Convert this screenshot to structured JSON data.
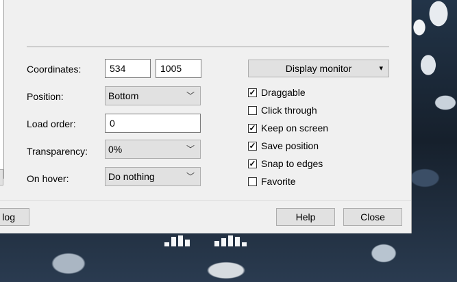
{
  "form": {
    "coordinates_label": "Coordinates:",
    "coord_x": "534",
    "coord_y": "1005",
    "position_label": "Position:",
    "position_value": "Bottom",
    "load_order_label": "Load order:",
    "load_order_value": "0",
    "transparency_label": "Transparency:",
    "transparency_value": "0%",
    "on_hover_label": "On hover:",
    "on_hover_value": "Do nothing"
  },
  "monitor": {
    "button_label": "Display monitor",
    "dropdown_glyph": "▾"
  },
  "options": [
    {
      "label": "Draggable",
      "checked": true
    },
    {
      "label": "Click through",
      "checked": false
    },
    {
      "label": "Keep on screen",
      "checked": true
    },
    {
      "label": "Save position",
      "checked": true
    },
    {
      "label": "Snap to edges",
      "checked": true
    },
    {
      "label": "Favorite",
      "checked": false
    }
  ],
  "footer": {
    "log_label": "log",
    "help_label": "Help",
    "close_label": "Close"
  },
  "icons": {
    "chevron": "chevron-down-icon",
    "check": "checkmark-icon"
  }
}
